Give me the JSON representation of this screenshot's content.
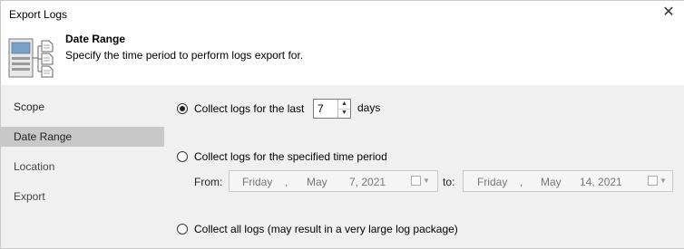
{
  "window": {
    "title": "Export Logs",
    "close_glyph": "✕"
  },
  "header": {
    "icon": "document-export-icon",
    "title": "Date Range",
    "description": "Specify the time period to perform logs export for."
  },
  "sidebar": {
    "items": [
      {
        "label": "Scope",
        "active": false
      },
      {
        "label": "Date Range",
        "active": true
      },
      {
        "label": "Location",
        "active": false
      },
      {
        "label": "Export",
        "active": false
      }
    ]
  },
  "options": {
    "last_days": {
      "label": "Collect logs for the last",
      "value": "7",
      "unit": "days",
      "checked": true
    },
    "period": {
      "label": "Collect logs for the specified time period",
      "checked": false,
      "from_label": "From:",
      "to_label": "to:",
      "from": {
        "weekday": "Friday",
        "sep": ",",
        "month": "May",
        "day_year": "7, 2021"
      },
      "to": {
        "weekday": "Friday",
        "sep": ",",
        "month": "May",
        "day_year": "14, 2021"
      }
    },
    "all_logs": {
      "label": "Collect all logs (may result in a very large log package)",
      "checked": false
    }
  }
}
